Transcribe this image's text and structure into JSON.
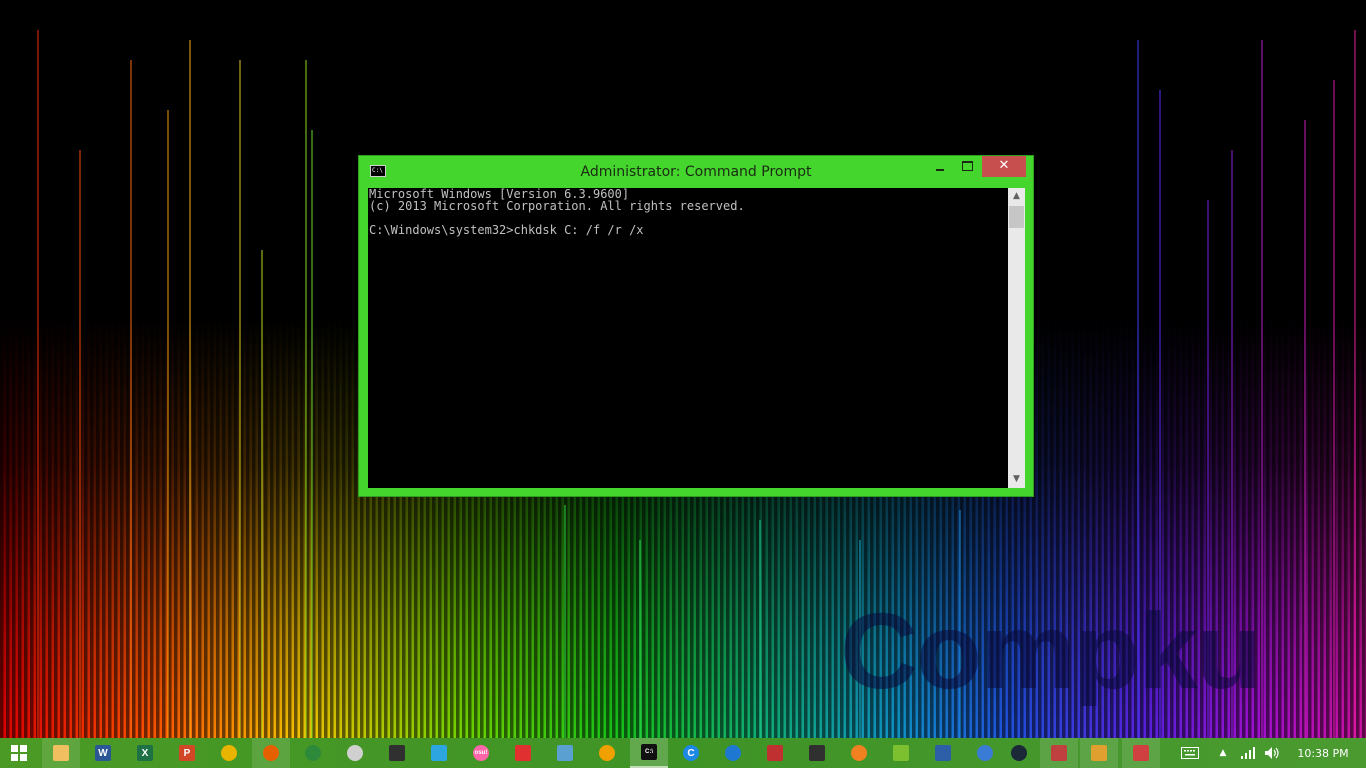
{
  "window": {
    "title": "Administrator: Command Prompt",
    "icon": "C:\\",
    "minimize_glyph": "",
    "maximize_glyph": "",
    "close_glyph": "✕",
    "console_text": "Microsoft Windows [Version 6.3.9600]\n(c) 2013 Microsoft Corporation. All rights reserved.\n\nC:\\Windows\\system32>chkdsk C: /f /r /x",
    "scroll_up_glyph": "▲",
    "scroll_down_glyph": "▼"
  },
  "wallpaper": {
    "watermark": "Compku"
  },
  "taskbar": {
    "start_icon": "windows-logo-icon",
    "apps": [
      {
        "icon": "file-explorer-icon",
        "color": "#f0c060",
        "glyph": "",
        "state": "running"
      },
      {
        "icon": "word-icon",
        "color": "#2b5797",
        "glyph": "W",
        "state": "pinned"
      },
      {
        "icon": "excel-icon",
        "color": "#1e7145",
        "glyph": "X",
        "state": "pinned"
      },
      {
        "icon": "powerpoint-icon",
        "color": "#d24726",
        "glyph": "P",
        "state": "pinned"
      },
      {
        "icon": "chrome-icon",
        "color": "#e8b400",
        "glyph": "",
        "state": "pinned"
      },
      {
        "icon": "firefox-icon",
        "color": "#e66000",
        "glyph": "",
        "state": "running"
      },
      {
        "icon": "globe-download-icon",
        "color": "#2d8a3a",
        "glyph": "",
        "state": "pinned"
      },
      {
        "icon": "webcam-icon",
        "color": "#d0d0d0",
        "glyph": "",
        "state": "pinned"
      },
      {
        "icon": "video-editor-icon",
        "color": "#303030",
        "glyph": "",
        "state": "pinned"
      },
      {
        "icon": "telegram-icon",
        "color": "#2ca5e0",
        "glyph": "",
        "state": "pinned"
      },
      {
        "icon": "osu-icon",
        "color": "#ff66aa",
        "glyph": "osu!",
        "state": "pinned"
      },
      {
        "icon": "racing-game-icon",
        "color": "#e03030",
        "glyph": "",
        "state": "pinned"
      },
      {
        "icon": "image-viewer-icon",
        "color": "#5aa0d0",
        "glyph": "",
        "state": "pinned"
      },
      {
        "icon": "vlc-icon",
        "color": "#f0a000",
        "glyph": "",
        "state": "pinned"
      },
      {
        "icon": "command-prompt-icon",
        "color": "#111111",
        "glyph": "C:\\",
        "state": "active"
      },
      {
        "icon": "ccleaner-icon",
        "color": "#1e88e5",
        "glyph": "C",
        "state": "pinned"
      },
      {
        "icon": "alarm-clock-icon",
        "color": "#1e78d2",
        "glyph": "",
        "state": "pinned"
      },
      {
        "icon": "shield-app-icon",
        "color": "#c03030",
        "glyph": "",
        "state": "pinned"
      },
      {
        "icon": "monitor-app-icon",
        "color": "#303030",
        "glyph": "",
        "state": "pinned"
      },
      {
        "icon": "gamepad-icon",
        "color": "#f08020",
        "glyph": "",
        "state": "pinned"
      },
      {
        "icon": "bluestacks-icon",
        "color": "#7cc030",
        "glyph": "",
        "state": "pinned"
      },
      {
        "icon": "settings-gear-icon",
        "color": "#2d5fa8",
        "glyph": "",
        "state": "pinned"
      },
      {
        "icon": "blue-globe-icon",
        "color": "#3a7bd5",
        "glyph": "",
        "state": "pinned"
      },
      {
        "icon": "steam-icon",
        "color": "#1b2838",
        "glyph": "",
        "state": "pinned"
      },
      {
        "icon": "paint-tool-icon",
        "color": "#c04040",
        "glyph": "",
        "state": "running"
      },
      {
        "icon": "paint-palette-icon",
        "color": "#e0a030",
        "glyph": "",
        "state": "running"
      },
      {
        "icon": "snipping-tool-icon",
        "color": "#d04040",
        "glyph": "",
        "state": "running"
      }
    ],
    "tray": {
      "keyboard_icon": "keyboard-icon",
      "show_hidden_glyph": "▲",
      "network_icon": "network-signal-icon",
      "volume_icon": "volume-icon",
      "clock": "10:38 PM"
    }
  }
}
